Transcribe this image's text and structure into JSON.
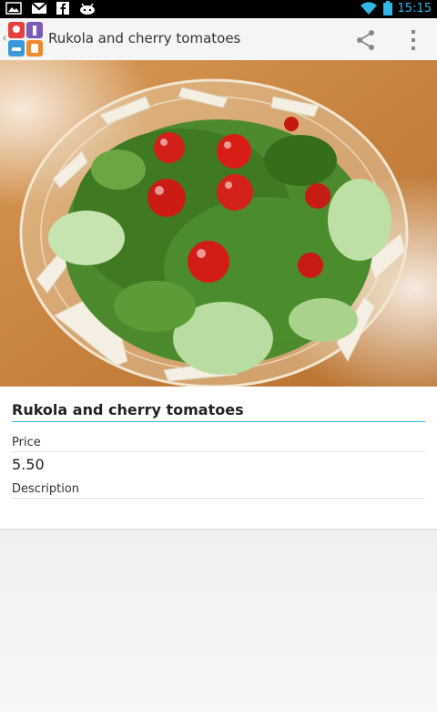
{
  "status_bar": {
    "time": "15:15",
    "icons": [
      "picture-icon",
      "gmail-icon",
      "facebook-icon",
      "android-icon",
      "wifi-icon",
      "battery-icon"
    ]
  },
  "action_bar": {
    "title": "Rukola and cherry tomatoes",
    "actions": [
      "share-icon",
      "overflow-menu-icon"
    ]
  },
  "item": {
    "name": "Rukola and cherry tomatoes",
    "price_label": "Price",
    "price_value": "5.50",
    "description_label": "Description",
    "description_value": ""
  },
  "colors": {
    "accent": "#33b5e5",
    "status_bar": "#000000",
    "action_bar": "#f5f5f5",
    "card": "#ffffff"
  }
}
